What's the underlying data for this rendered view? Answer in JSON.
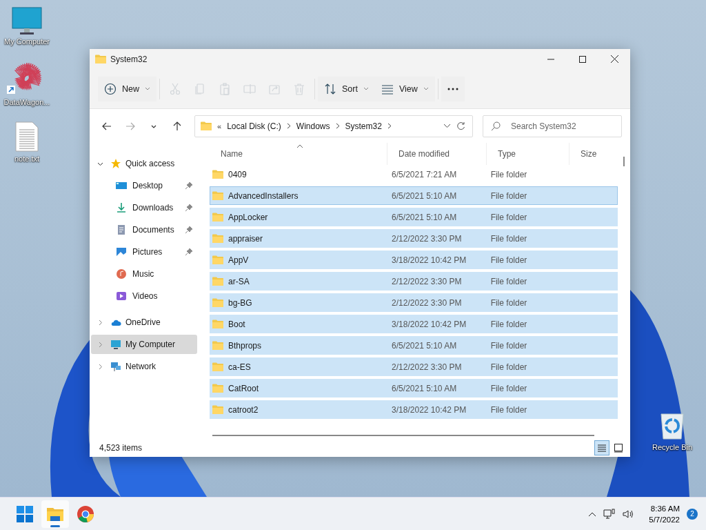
{
  "desktop_icons": [
    {
      "kind": "computer",
      "label": "My Computer",
      "shortcut": false
    },
    {
      "kind": "app",
      "label": "DataWagon...",
      "shortcut": true
    },
    {
      "kind": "text-file",
      "label": "note.txt",
      "shortcut": false
    },
    {
      "kind": "recycle-bin",
      "label": "Recycle Bin",
      "shortcut": false
    }
  ],
  "window": {
    "title": "System32",
    "toolbar": [
      {
        "kind": "new",
        "label": "New",
        "disabled": false
      },
      {
        "kind": "cut",
        "disabled": true
      },
      {
        "kind": "copy",
        "disabled": true
      },
      {
        "kind": "paste",
        "disabled": true
      },
      {
        "kind": "rename",
        "disabled": true
      },
      {
        "kind": "share",
        "disabled": true
      },
      {
        "kind": "delete",
        "disabled": true
      },
      {
        "kind": "sort",
        "label": "Sort",
        "disabled": false
      },
      {
        "kind": "view",
        "label": "View",
        "disabled": false
      },
      {
        "kind": "more",
        "disabled": false
      }
    ],
    "navigation": [
      {
        "kind": "back",
        "disabled": false
      },
      {
        "kind": "forward",
        "disabled": true
      },
      {
        "kind": "recent",
        "disabled": false
      },
      {
        "kind": "up",
        "disabled": false
      }
    ],
    "address": {
      "overflow": "«",
      "segments": [
        "Local Disk (C:)",
        "Windows",
        "System32"
      ]
    },
    "search": {
      "placeholder": "Search System32"
    },
    "sidebar": [
      {
        "kind": "star",
        "label": "Quick access",
        "expanded": true,
        "selected": false,
        "children": [
          {
            "kind": "desktop",
            "label": "Desktop",
            "pinned": true,
            "selected": false
          },
          {
            "kind": "downloads",
            "label": "Downloads",
            "pinned": true,
            "selected": false
          },
          {
            "kind": "documents",
            "label": "Documents",
            "pinned": true,
            "selected": false
          },
          {
            "kind": "pictures",
            "label": "Pictures",
            "pinned": true,
            "selected": false
          },
          {
            "kind": "music",
            "label": "Music",
            "pinned": false,
            "selected": false
          },
          {
            "kind": "videos",
            "label": "Videos",
            "pinned": false,
            "selected": false
          }
        ]
      },
      {
        "kind": "cloud",
        "label": "OneDrive",
        "expanded": false,
        "selected": false
      },
      {
        "kind": "computer",
        "label": "My Computer",
        "expanded": false,
        "selected": true
      },
      {
        "kind": "network",
        "label": "Network",
        "expanded": false,
        "selected": false
      }
    ],
    "columns": [
      {
        "label": "Name",
        "sorted": true
      },
      {
        "label": "Date modified",
        "sorted": false
      },
      {
        "label": "Type",
        "sorted": false
      },
      {
        "label": "Size",
        "sorted": false
      }
    ],
    "rows": [
      {
        "name": "0409",
        "date": "6/5/2021 7:21 AM",
        "type": "File folder",
        "selected": false
      },
      {
        "name": "AdvancedInstallers",
        "date": "6/5/2021 5:10 AM",
        "type": "File folder",
        "selected": true
      },
      {
        "name": "AppLocker",
        "date": "6/5/2021 5:10 AM",
        "type": "File folder",
        "selected": true
      },
      {
        "name": "appraiser",
        "date": "2/12/2022 3:30 PM",
        "type": "File folder",
        "selected": true
      },
      {
        "name": "AppV",
        "date": "3/18/2022 10:42 PM",
        "type": "File folder",
        "selected": true
      },
      {
        "name": "ar-SA",
        "date": "2/12/2022 3:30 PM",
        "type": "File folder",
        "selected": true
      },
      {
        "name": "bg-BG",
        "date": "2/12/2022 3:30 PM",
        "type": "File folder",
        "selected": true
      },
      {
        "name": "Boot",
        "date": "3/18/2022 10:42 PM",
        "type": "File folder",
        "selected": true
      },
      {
        "name": "Bthprops",
        "date": "6/5/2021 5:10 AM",
        "type": "File folder",
        "selected": true
      },
      {
        "name": "ca-ES",
        "date": "2/12/2022 3:30 PM",
        "type": "File folder",
        "selected": true
      },
      {
        "name": "CatRoot",
        "date": "6/5/2021 5:10 AM",
        "type": "File folder",
        "selected": true
      },
      {
        "name": "catroot2",
        "date": "3/18/2022 10:42 PM",
        "type": "File folder",
        "selected": true
      }
    ],
    "status": "4,523 items",
    "views": [
      {
        "kind": "details",
        "selected": true
      },
      {
        "kind": "tiles",
        "selected": false
      }
    ]
  },
  "taskbar": {
    "apps": [
      {
        "kind": "start",
        "active": false
      },
      {
        "kind": "explorer",
        "active": true
      },
      {
        "kind": "browser",
        "active": false
      }
    ],
    "tray": {
      "time": "8:36 AM",
      "date": "5/7/2022",
      "notifications": "2"
    }
  }
}
